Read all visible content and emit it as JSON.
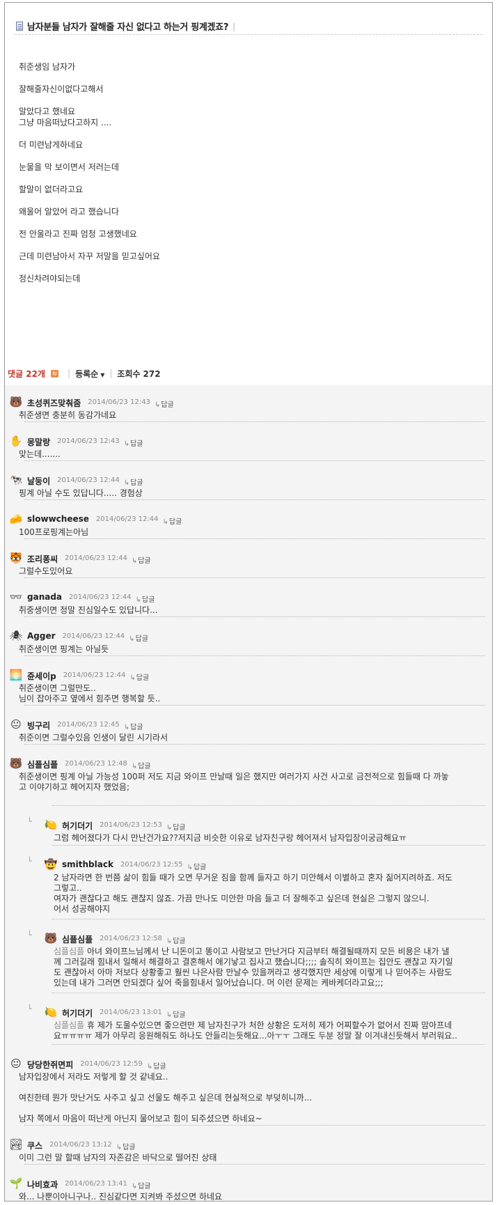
{
  "post": {
    "title": "남자분들 남자가 잘해줄 자신 없다고 하는거 핑계겠죠?",
    "title_separator": "|",
    "body": [
      "취준생임 남자가",
      "잘해줄자신이없다고해서",
      "알았다고 했네요",
      "그냥 마음떠났다고하지 ....",
      "더 미련남게하네요",
      "눈물을 막 보이면서 저러는데",
      "할말이 없더라고요",
      "왜울어 알았어 라고 했습니다",
      "전 안울라고 진짜 엄청 고생했네요",
      "근데 미련남아서 자꾸 저말을 믿고싶어요",
      "정신차려야되는데"
    ]
  },
  "comment_bar": {
    "comments_label": "댓글",
    "comments_count": "22개",
    "sort_label": "등록순",
    "sort_caret": "▼",
    "views_label": "조회수",
    "views_count": "272",
    "separator": "|"
  },
  "reply_label": "답글",
  "reply_arrow": "↳",
  "indent_mark": "└",
  "comments": [
    {
      "nick": "초성퀴즈맞춰줌",
      "date": "2014/06/23 12:43",
      "lines": [
        "취준생면 충분히 동감가네요"
      ],
      "avatar_icon": "bear-icon",
      "avatar_glyph": "🐻"
    },
    {
      "nick": "몽말랑",
      "date": "2014/06/23 12:43",
      "lines": [
        "맞는데......."
      ],
      "avatar_icon": "hand-icon",
      "avatar_glyph": "✋"
    },
    {
      "nick": "날둥이",
      "date": "2014/06/23 12:44",
      "lines": [
        "핑계 아닐 수도 있답니다..... 경험상"
      ],
      "avatar_icon": "cow-icon",
      "avatar_glyph": "🐄"
    },
    {
      "nick": "slowwcheese",
      "date": "2014/06/23 12:44",
      "lines": [
        "100프로핑계는아님"
      ],
      "avatar_icon": "cheese-icon",
      "avatar_glyph": "🧀"
    },
    {
      "nick": "조리퐁씨",
      "date": "2014/06/23 12:44",
      "lines": [
        "그럴수도있어요"
      ],
      "avatar_icon": "tiger-icon",
      "avatar_glyph": "🐯"
    },
    {
      "nick": "ganada",
      "date": "2014/06/23 12:44",
      "lines": [
        "취중생이면 정말 진심일수도 있답니다..."
      ],
      "avatar_icon": "glasses-icon",
      "avatar_glyph": "👓"
    },
    {
      "nick": "Agger",
      "date": "2014/06/23 12:44",
      "lines": [
        "취준생이면 핑계는 아닐듯"
      ],
      "avatar_icon": "spider-icon",
      "avatar_glyph": "🕷"
    },
    {
      "nick": "쥰세이p",
      "date": "2014/06/23 12:44",
      "lines": [
        "취준생이면 그럴만도..",
        "님이 잡아주고 옆에서 힘주면 행복할 듯.."
      ],
      "avatar_icon": "sunset-icon",
      "avatar_glyph": "🌅"
    },
    {
      "nick": "빙구리",
      "date": "2014/06/23 12:45",
      "lines": [
        "취준이면 그럴수있음 인생이 달린 시기라서"
      ],
      "avatar_icon": "face-icon",
      "avatar_glyph": "😐"
    },
    {
      "nick": "심플심플",
      "date": "2014/06/23 12:48",
      "lines": [
        "취준생이면 핑계 아닐 가능성 100퍼 저도 지금 와이프 만날때 일은 했지만 여러가지 사건 사고로 금전적으로 힘들때 다 까놓",
        "고 이야기하고 헤어지자 했었음;"
      ],
      "avatar_icon": "bear-face-icon",
      "avatar_glyph": "🐻"
    },
    {
      "nick": "허기더기",
      "date": "2014/06/23 12:53",
      "lines": [
        "그럼 헤어졌다가 다시 만난건가요??저지금 비슷한 이유로 남자친구랑 헤어져서 남자입장이궁금해요ㅠ"
      ],
      "avatar_icon": "lemon-icon",
      "avatar_glyph": "🍋",
      "nested": true
    },
    {
      "nick": "smithblack",
      "date": "2014/06/23 12:55",
      "lines": [
        "2 남자라면 한 번쯤 삶이 힘들 때가 오면 무거운 짐을 함께 들자고 하기 미안해서 이별하고 혼자 짊어지려하죠. 저도",
        "그렇고..",
        "여자가 괜찮다고 해도 괜찮지 않죠. 가끔 만나도 미안한 마음 들고 더 잘해주고 싶은데 현실은 그렇지 않으니.",
        "어서 성공해야지"
      ],
      "avatar_icon": "cowboy-icon",
      "avatar_glyph": "🤠",
      "nested": true
    },
    {
      "nick": "심플심플",
      "date": "2014/06/23 12:58",
      "mention": "심플심플",
      "lines": [
        "아녀 와이프느님께서 난 니돈이고 똥이고 사람보고 만난거다 지금부터 해결될때까지 모든 비용은 내가 낼",
        "께 그러길래 힘내서 일해서 해결하고 결혼해서 애기낳고 집사고 했습니다;;;; 솔직히 와이프는 집안도 괜찮고 자기일",
        "도 괜찮아서 아마 저보다 상황좋고 훨씬 나은사람 만날수 있을꺼라고 생각했지만 세상에 이렇게 나 믿어주는 사람도",
        "있는데 내가 그러면 안되겠다 싶어 죽을힘내서 일어났습니다. 머 이런 문제는 케바케더라고요;;;"
      ],
      "avatar_icon": "bear-face-icon",
      "avatar_glyph": "🐻",
      "nested": true
    },
    {
      "nick": "허기더기",
      "date": "2014/06/23 13:01",
      "mention": "심플심플",
      "lines": [
        "휴 제가 도울수있으면 좋으련만 제 남자친구가 처한 상황은 도저히 제가 어찌할수가 없어서 진짜 맘아프네",
        "요ㅠㅠㅠㅠ 제가 아무리 응원해줘도 하나도 안들리는듯해요...아ㅜㅜ 그래도 두분 정말 잘 이겨내신듯해서 부러워요.."
      ],
      "avatar_icon": "lemon-icon",
      "avatar_glyph": "🍋",
      "nested": true
    },
    {
      "nick": "당당한쥐면피",
      "date": "2014/06/23 12:59",
      "lines": [
        "남자입장에서 저라도 저렇게 할 것 같네요..",
        "",
        "여친한테 뭔가 맛난거도 사주고 싶고 선물도 해주고 싶은데 현실적으로 부덪히니까...",
        "",
        "남자 쪽에서 마음이 떠난게 아닌지 물어보고 힘이 되주셨으면 하네요~"
      ],
      "avatar_icon": "face-icon",
      "avatar_glyph": "😐"
    },
    {
      "nick": "쿠스",
      "date": "2014/06/23 13:12",
      "lines": [
        "이미 그런 말 할때 남자의 자존감은 바닥으로 떨어진 상태"
      ],
      "avatar_icon": "sky-icon",
      "avatar_glyph": "🏞"
    },
    {
      "nick": "나비효과",
      "date": "2014/06/23 13:41",
      "lines": [
        "와... 나뿐이아니구나.. 진심같다면 지켜봐 주셨으면 하네요"
      ],
      "avatar_icon": "plant-icon",
      "avatar_glyph": "🌱"
    }
  ]
}
